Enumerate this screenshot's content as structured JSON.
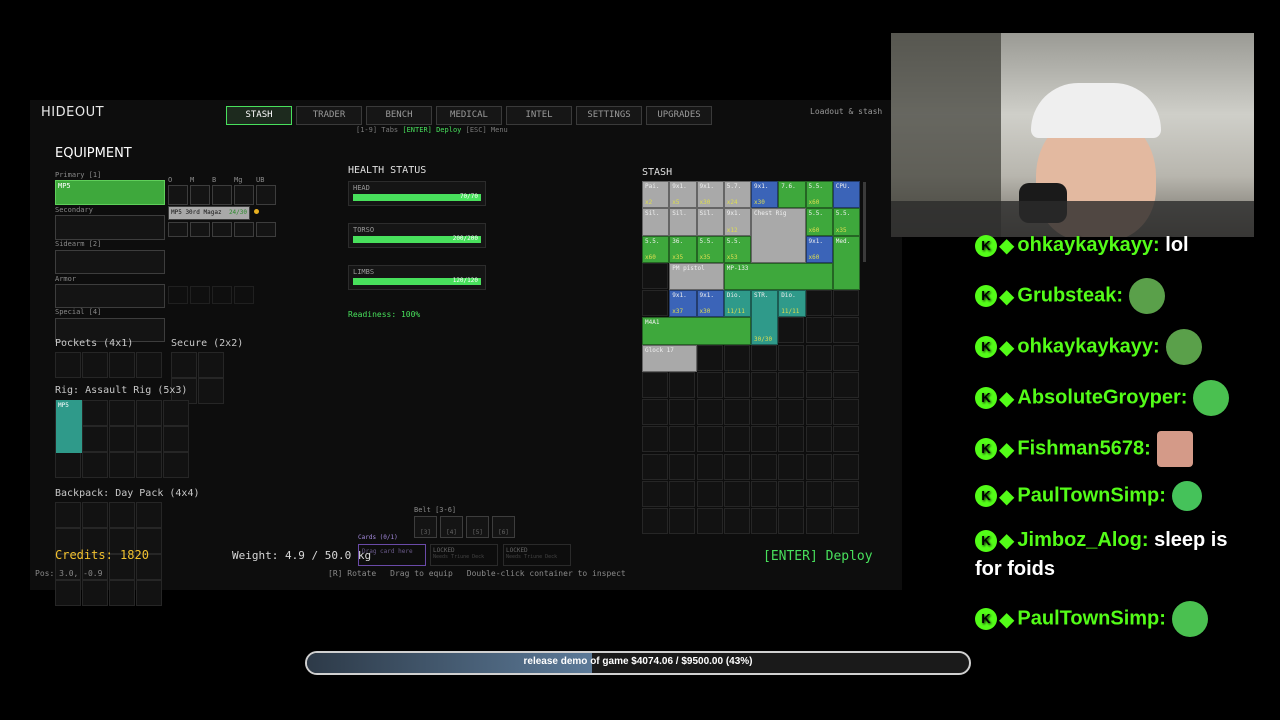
{
  "game": {
    "title": "HIDEOUT",
    "tabs": [
      {
        "label": "STASH",
        "active": true
      },
      {
        "label": "TRADER",
        "active": false
      },
      {
        "label": "BENCH",
        "active": false
      },
      {
        "label": "MEDICAL",
        "active": false
      },
      {
        "label": "INTEL",
        "active": false
      },
      {
        "label": "SETTINGS",
        "active": false
      },
      {
        "label": "UPGRADES",
        "active": false
      }
    ],
    "hint_prefix": "[1-9] Tabs",
    "hint_deploy": "[ENTER] Deploy",
    "hint_menu": "[ESC] Menu",
    "top_right": "Loadout & stash",
    "equipment": {
      "title": "EQUIPMENT",
      "primary_label": "Primary [1]",
      "primary_item": "MP5",
      "secondary_label": "Secondary",
      "sidearm_label": "Sidearm [2]",
      "armor_label": "Armor",
      "special_label": "Special [4]",
      "attach_labels": [
        "O",
        "M",
        "B",
        "Mg",
        "UB"
      ],
      "magazine_item": "MP5 30rd Magaz",
      "magazine_count": "24/30",
      "pockets_label": "Pockets (4x1)",
      "secure_label": "Secure (2x2)",
      "rig_label": "Rig: Assault Rig (5x3)",
      "rig_item": "MP5",
      "backpack_label": "Backpack: Day Pack (4x4)"
    },
    "health": {
      "title": "HEALTH STATUS",
      "parts": [
        {
          "name": "HEAD",
          "value": "70/70",
          "fraction": 1.0
        },
        {
          "name": "TORSO",
          "value": "200/200",
          "fraction": 1.0
        },
        {
          "name": "LIMBS",
          "value": "120/120",
          "fraction": 1.0
        }
      ],
      "readiness": "Readiness: 100%"
    },
    "stash": {
      "title": "STASH",
      "items": [
        {
          "label": "Pai.",
          "qty": "x2",
          "color": "gy"
        },
        {
          "label": "9x1.",
          "qty": "x5",
          "color": "gy"
        },
        {
          "label": "9x1.",
          "qty": "x30",
          "color": "gy"
        },
        {
          "label": "5.7.",
          "qty": "x24",
          "color": "gy"
        },
        {
          "label": "9x1.",
          "qty": "x30",
          "color": "bl"
        },
        {
          "label": "7.6.",
          "qty": "",
          "color": "g"
        },
        {
          "label": "5.5.",
          "qty": "x60",
          "color": "g"
        },
        {
          "label": "CPU.",
          "qty": "",
          "color": "bl"
        },
        {
          "label": "Sil.",
          "qty": "",
          "color": "gy"
        },
        {
          "label": "Sil.",
          "qty": "",
          "color": "gy"
        },
        {
          "label": "Sil.",
          "qty": "",
          "color": "gy"
        },
        {
          "label": "9x1.",
          "qty": "x12",
          "color": "gy"
        },
        {
          "label": "Chest Rig",
          "qty": "",
          "color": "gy"
        },
        {
          "label": "5.5.",
          "qty": "x60",
          "color": "g"
        },
        {
          "label": "5.5.",
          "qty": "x35",
          "color": "g"
        },
        {
          "label": "5.5.",
          "qty": "x60",
          "color": "g"
        },
        {
          "label": "36.",
          "qty": "x35",
          "color": "g"
        },
        {
          "label": "5.5.",
          "qty": "x35",
          "color": "g"
        },
        {
          "label": "5.5.",
          "qty": "x53",
          "color": "g"
        },
        {
          "label": "9x1.",
          "qty": "x60",
          "color": "bl"
        },
        {
          "label": "Med.",
          "qty": "",
          "color": "g"
        },
        {
          "label": "PM pistol",
          "qty": "",
          "color": "gy"
        },
        {
          "label": "MP-133",
          "qty": "",
          "color": "g"
        },
        {
          "label": "9x1.",
          "qty": "x37",
          "color": "bl"
        },
        {
          "label": "9x1.",
          "qty": "x30",
          "color": "bl"
        },
        {
          "label": "Dio.",
          "qty": "11/11",
          "color": "tl"
        },
        {
          "label": "STR.",
          "qty": "30/30",
          "color": "tl"
        },
        {
          "label": "Dio.",
          "qty": "11/11",
          "color": "tl"
        },
        {
          "label": "M4A1",
          "qty": "",
          "color": "g"
        },
        {
          "label": "Glock 17",
          "qty": "",
          "color": "gy"
        }
      ]
    },
    "belt_label": "Belt [3-6]",
    "belt_slots": [
      "[3]",
      "[4]",
      "[5]",
      "[6]"
    ],
    "cards_label": "Cards (0/1)",
    "drag_card": "Drag card here",
    "locked": [
      {
        "title": "LOCKED",
        "sub": "Needs Triune Deck"
      },
      {
        "title": "LOCKED",
        "sub": "Needs Triune Deck"
      }
    ],
    "credits": "Credits: 1820",
    "weight": "Weight: 4.9 / 50.0 kg",
    "pos": "Pos: 3.0, -0.9",
    "footer_hints": [
      "[R] Rotate",
      "Drag to equip",
      "Double-click container to inspect"
    ],
    "deploy": "[ENTER] Deploy"
  },
  "chat": [
    {
      "user": "ohkaykaykayy:",
      "msg": "lol",
      "emote": ""
    },
    {
      "user": "Grubsteak:",
      "msg": "",
      "emote": "pepe-scream-emote"
    },
    {
      "user": "ohkaykaykayy:",
      "msg": "",
      "emote": "pepe-scream-emote"
    },
    {
      "user": "AbsoluteGroyper:",
      "msg": "",
      "emote": "groyper-emote"
    },
    {
      "user": "Fishman5678:",
      "msg": "",
      "emote": "face-emote"
    },
    {
      "user": "PaulTownSimp:",
      "msg": "",
      "emote": "green-smile-emote"
    },
    {
      "user": "Jimboz_Alog:",
      "msg": "sleep is",
      "emote": ""
    },
    {
      "user": "PaulTownSimp:",
      "msg": "",
      "emote": "headphone-emote"
    }
  ],
  "chat_wrap": "for foids",
  "goal": {
    "text": "release demo of game $4074.06 / $9500.00 (43%)",
    "progress": 0.43
  }
}
